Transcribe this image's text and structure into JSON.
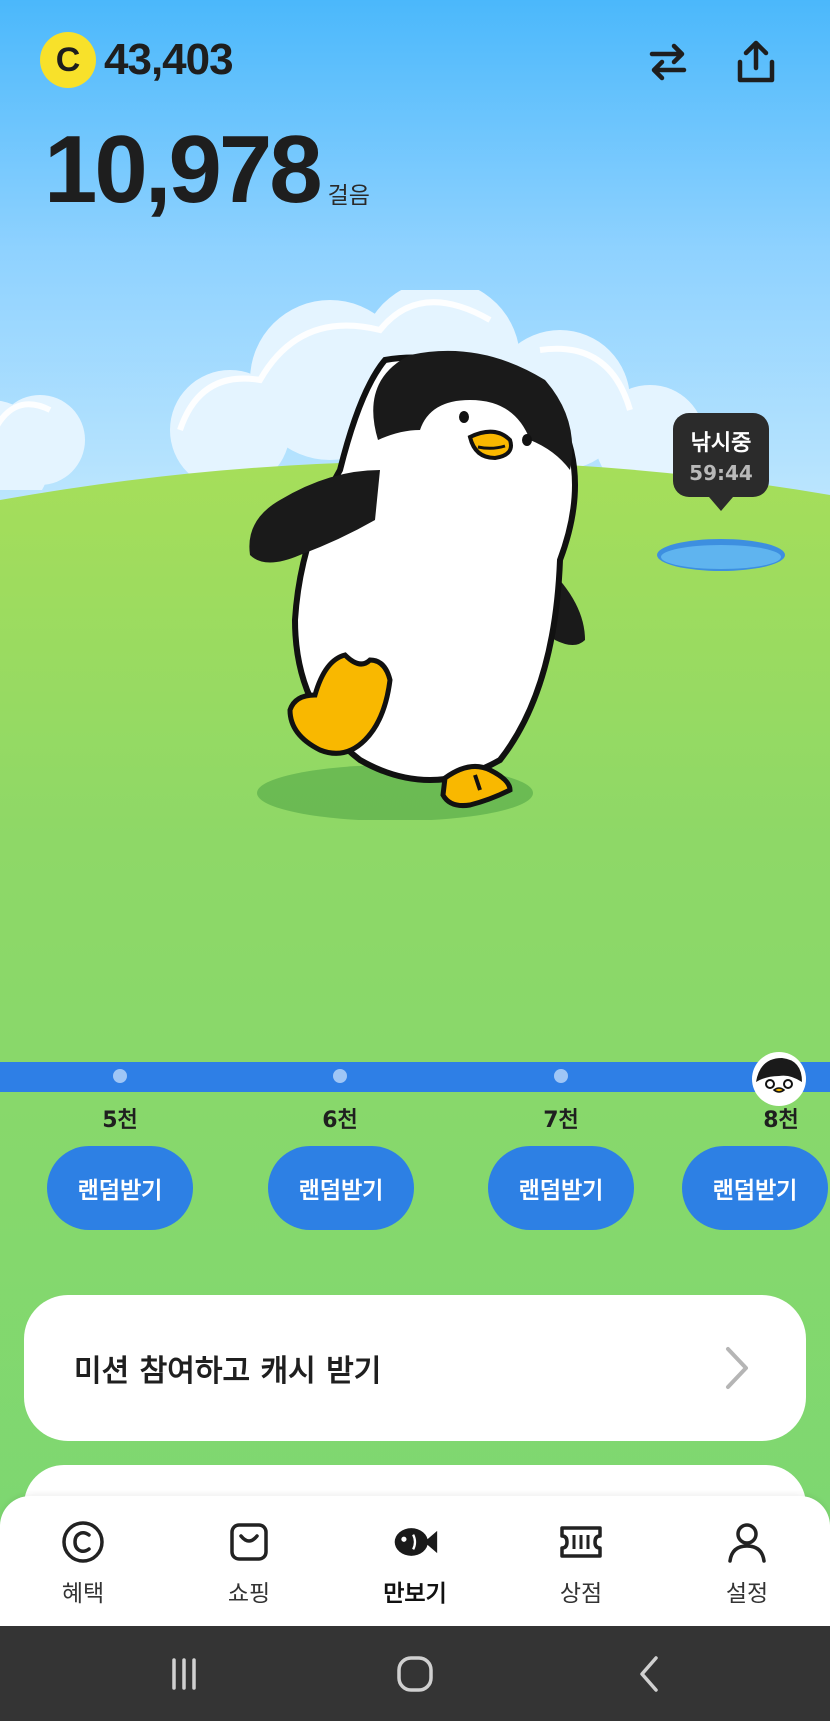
{
  "header": {
    "coin_symbol": "C",
    "coin_balance": "43,403",
    "step_count": "10,978",
    "step_unit": "걸음",
    "icons": [
      "swap-icon",
      "share-icon"
    ]
  },
  "fishing": {
    "label": "낚시중",
    "timer": "59:44"
  },
  "milestones": [
    {
      "label": "5천",
      "button": "랜덤받기"
    },
    {
      "label": "6천",
      "button": "랜덤받기"
    },
    {
      "label": "7천",
      "button": "랜덤받기"
    },
    {
      "label": "8천",
      "button": "랜덤받기"
    }
  ],
  "mission": {
    "label": "미션 참여하고 캐시 받기"
  },
  "bottom_nav": {
    "active": "만보기",
    "items": [
      {
        "label": "혜택",
        "icon": "coin-c-icon"
      },
      {
        "label": "쇼핑",
        "icon": "shopping-bag-icon"
      },
      {
        "label": "만보기",
        "icon": "fish-icon"
      },
      {
        "label": "상점",
        "icon": "ticket-icon"
      },
      {
        "label": "설정",
        "icon": "person-icon"
      }
    ]
  },
  "system_nav": {
    "icons": [
      "recent-apps-icon",
      "home-icon",
      "back-icon"
    ]
  },
  "colors": {
    "sky": "#4bb8fb",
    "grass": "#80d873",
    "accent_blue": "#2e7fe6",
    "coin_yellow": "#f8e12a",
    "penguin_foot": "#f9b800"
  }
}
